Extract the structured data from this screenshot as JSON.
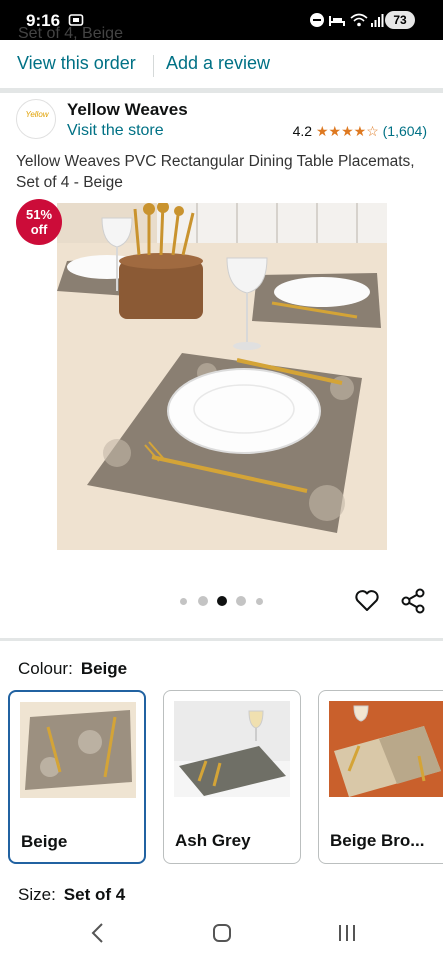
{
  "status_bar": {
    "time": "9:16",
    "battery": "73"
  },
  "order": {
    "partial_text": "Set of 4, Beige",
    "view_order": "View this order",
    "add_review": "Add a review"
  },
  "brand": {
    "logo_text": "Yellow",
    "name": "Yellow Weaves",
    "visit_store": "Visit the store",
    "rating": "4.2",
    "stars": "★★★★☆",
    "review_count": "(1,604)"
  },
  "product": {
    "title": "Yellow Weaves PVC Rectangular Dining Table Placemats, Set of 4 - Beige",
    "discount_pct": "51%",
    "discount_word": "off"
  },
  "carousel": {
    "image_count": 5,
    "active_index": 2
  },
  "colour": {
    "label": "Colour:",
    "selected": "Beige",
    "options": [
      {
        "label": "Beige"
      },
      {
        "label": "Ash Grey"
      },
      {
        "label": "Beige Bro..."
      }
    ]
  },
  "size": {
    "label": "Size:",
    "selected": "Set of 4"
  },
  "colors": {
    "link": "#007185",
    "star": "#de7921",
    "badge": "#cc0c39",
    "selected_border": "#2162a1"
  }
}
